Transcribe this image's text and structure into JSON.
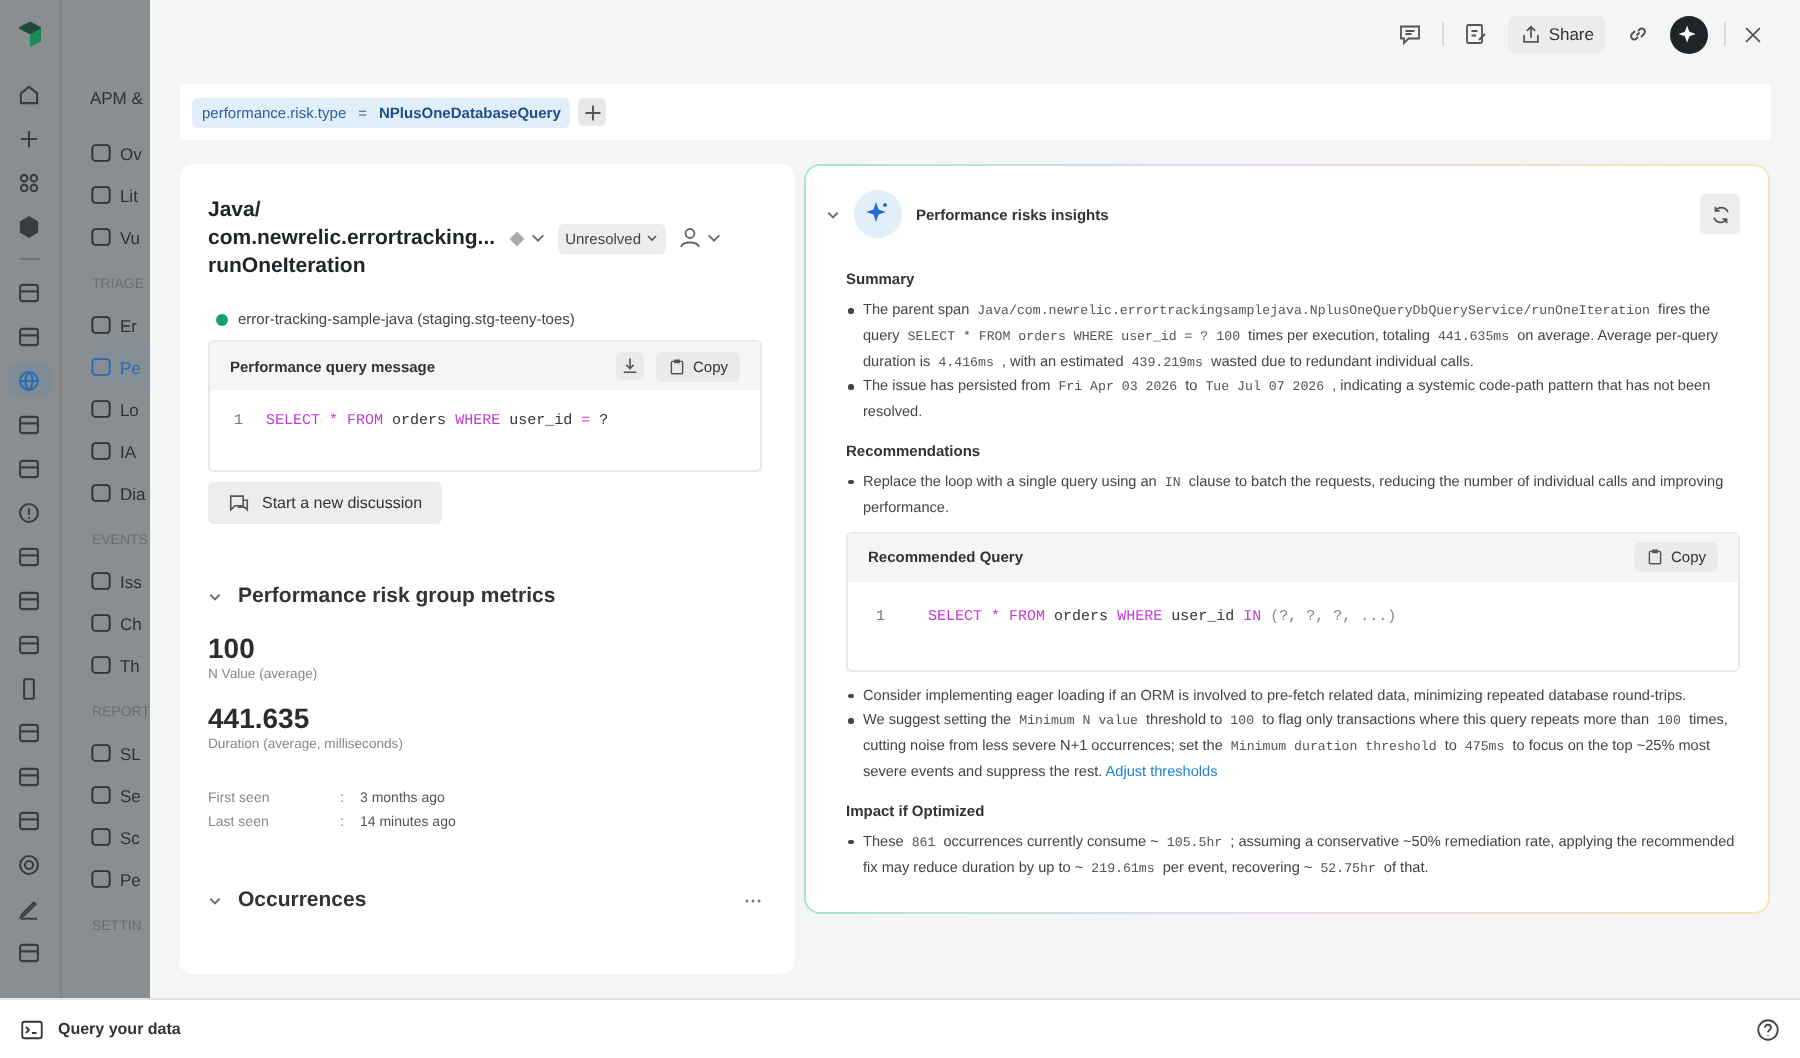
{
  "rail": [
    {
      "selected": false
    },
    {
      "selected": false
    },
    {
      "selected": false
    },
    {
      "selected": false
    },
    {
      "selected": false
    },
    {
      "selected": false
    },
    {
      "selected": true
    },
    {
      "selected": false
    },
    {
      "selected": false
    },
    {
      "selected": false
    },
    {
      "selected": false
    },
    {
      "selected": false
    },
    {
      "selected": false
    },
    {
      "selected": false
    },
    {
      "selected": false
    },
    {
      "selected": false
    },
    {
      "selected": false
    },
    {
      "selected": false
    },
    {
      "selected": false
    },
    {
      "selected": false
    }
  ],
  "nav": {
    "heading": "APM &",
    "groups": [
      {
        "items": [
          {
            "label": "Ov",
            "selected": false
          },
          {
            "label": "Lit",
            "selected": false
          },
          {
            "label": "Vu",
            "selected": false
          }
        ]
      },
      {
        "title": "TRIAGE",
        "items": [
          {
            "label": "Er",
            "selected": false
          },
          {
            "label": "Pe",
            "selected": true
          },
          {
            "label": "Lo",
            "selected": false
          },
          {
            "label": "IA",
            "selected": false
          },
          {
            "label": "Dia",
            "selected": false
          }
        ]
      },
      {
        "title": "EVENTS",
        "items": [
          {
            "label": "Iss",
            "selected": false
          },
          {
            "label": "Ch",
            "selected": false
          },
          {
            "label": "Th",
            "selected": false
          }
        ]
      },
      {
        "title": "REPORT",
        "items": [
          {
            "label": "SL",
            "selected": false
          },
          {
            "label": "Se",
            "selected": false
          },
          {
            "label": "Sc",
            "selected": false
          },
          {
            "label": "Pe",
            "selected": false
          }
        ]
      },
      {
        "title": "SETTIN"
      }
    ]
  },
  "toolbar": {
    "share": "Share"
  },
  "filter": {
    "key": "performance.risk.type",
    "op": "=",
    "value": "NPlusOneDatabaseQuery"
  },
  "issue": {
    "title_lines": [
      "Java/",
      "com.newrelic.errortracking...",
      "runOneIteration"
    ],
    "status": "Unresolved",
    "entity": "error-tracking-sample-java (staging.stg-teeny-toes)"
  },
  "query_message": {
    "title": "Performance query message",
    "copy": "Copy",
    "lines": [
      {
        "number": "1",
        "tokens": [
          {
            "kind": "kw",
            "text": "SELECT"
          },
          {
            "kind": "op",
            "text": "*"
          },
          {
            "kind": "kw",
            "text": "FROM"
          },
          {
            "kind": "plain",
            "text": "orders"
          },
          {
            "kind": "kw",
            "text": "WHERE"
          },
          {
            "kind": "plain",
            "text": "user_id"
          },
          {
            "kind": "op",
            "text": "="
          },
          {
            "kind": "plain",
            "text": "?"
          }
        ]
      }
    ]
  },
  "discussion_button": "Start a new discussion",
  "metrics": {
    "title": "Performance risk group metrics",
    "items": [
      {
        "value": "100",
        "label": "N Value (average)"
      },
      {
        "value": "441.635",
        "label": "Duration (average, milliseconds)"
      }
    ],
    "details": [
      {
        "label": "First seen",
        "separator": ":",
        "value": "3 months ago"
      },
      {
        "label": "Last seen",
        "separator": ":",
        "value": "14 minutes ago"
      }
    ]
  },
  "occurrences": {
    "title": "Occurrences"
  },
  "insights": {
    "title": "Performance risks insights",
    "sections": [
      {
        "heading": "Summary",
        "blocks": [
          {
            "kind": "bullet",
            "segments": [
              {
                "kind": "text",
                "text": "The parent span "
              },
              {
                "kind": "code",
                "text": "Java/com.newrelic.errortrackingsamplejava.NplusOneQueryDbQueryService/runOneIteration"
              },
              {
                "kind": "text",
                "text": " fires the query "
              },
              {
                "kind": "code",
                "text": "SELECT * FROM orders WHERE user_id = ?"
              },
              {
                "kind": "code",
                "text": "100"
              },
              {
                "kind": "text",
                "text": " times per execution, totaling "
              },
              {
                "kind": "code",
                "text": "441.635ms"
              },
              {
                "kind": "text",
                "text": " on average. Average per-query duration is "
              },
              {
                "kind": "code",
                "text": "4.416ms"
              },
              {
                "kind": "text",
                "text": " , with an estimated "
              },
              {
                "kind": "code",
                "text": "439.219ms"
              },
              {
                "kind": "text",
                "text": " wasted due to redundant individual calls."
              }
            ]
          },
          {
            "kind": "bullet",
            "segments": [
              {
                "kind": "text",
                "text": "The issue has persisted from "
              },
              {
                "kind": "code",
                "text": "Fri Apr 03 2026"
              },
              {
                "kind": "text",
                "text": " to "
              },
              {
                "kind": "code",
                "text": "Tue Jul 07 2026"
              },
              {
                "kind": "text",
                "text": " , indicating a systemic code-path pattern that has not been resolved."
              }
            ]
          }
        ]
      },
      {
        "heading": "Recommendations",
        "blocks": [
          {
            "kind": "bullet",
            "segments": [
              {
                "kind": "text",
                "text": "Replace the loop with a single query using an "
              },
              {
                "kind": "code",
                "text": "IN"
              },
              {
                "kind": "text",
                "text": " clause to batch the requests, reducing the number of individual calls and improving performance."
              }
            ]
          },
          {
            "kind": "code",
            "title": "Recommended Query",
            "copy": "Copy",
            "lines": [
              {
                "number": "1",
                "tokens": [
                  {
                    "kind": "kw",
                    "text": "SELECT"
                  },
                  {
                    "kind": "op",
                    "text": "*"
                  },
                  {
                    "kind": "kw",
                    "text": "FROM"
                  },
                  {
                    "kind": "plain",
                    "text": "orders"
                  },
                  {
                    "kind": "kw",
                    "text": "WHERE"
                  },
                  {
                    "kind": "plain",
                    "text": "user_id"
                  },
                  {
                    "kind": "kw",
                    "text": "IN"
                  },
                  {
                    "kind": "muted",
                    "text": "(?, ?, ?, ...)"
                  }
                ]
              }
            ]
          },
          {
            "kind": "bullet",
            "segments": [
              {
                "kind": "text",
                "text": "Consider implementing eager loading if an ORM is involved to pre-fetch related data, minimizing repeated database round-trips."
              }
            ]
          },
          {
            "kind": "bullet",
            "segments": [
              {
                "kind": "text",
                "text": "We suggest setting the "
              },
              {
                "kind": "code",
                "text": "Minimum N value"
              },
              {
                "kind": "text",
                "text": " threshold to "
              },
              {
                "kind": "code",
                "text": "100"
              },
              {
                "kind": "text",
                "text": " to flag only transactions where this query repeats more than "
              },
              {
                "kind": "code",
                "text": "100"
              },
              {
                "kind": "text",
                "text": " times, cutting noise from less severe N+1 occurrences; set the "
              },
              {
                "kind": "code",
                "text": "Minimum duration threshold"
              },
              {
                "kind": "text",
                "text": " to "
              },
              {
                "kind": "code",
                "text": "475ms"
              },
              {
                "kind": "text",
                "text": " to focus on the top ~25% most severe events and suppress the rest. "
              },
              {
                "kind": "link",
                "text": "Adjust thresholds"
              }
            ]
          }
        ]
      },
      {
        "heading": "Impact if Optimized",
        "blocks": [
          {
            "kind": "bullet",
            "segments": [
              {
                "kind": "text",
                "text": "These "
              },
              {
                "kind": "code",
                "text": "861"
              },
              {
                "kind": "text",
                "text": " occurrences currently consume ~ "
              },
              {
                "kind": "code",
                "text": "105.5hr"
              },
              {
                "kind": "text",
                "text": " ; assuming a conservative ~50% remediation rate, applying the recommended fix may reduce duration by up to ~ "
              },
              {
                "kind": "code",
                "text": "219.61ms"
              },
              {
                "kind": "text",
                "text": " per event, recovering ~ "
              },
              {
                "kind": "code",
                "text": "52.75hr"
              },
              {
                "kind": "text",
                "text": " of that."
              }
            ]
          }
        ]
      }
    ]
  },
  "footer": {
    "label": "Query your data"
  }
}
